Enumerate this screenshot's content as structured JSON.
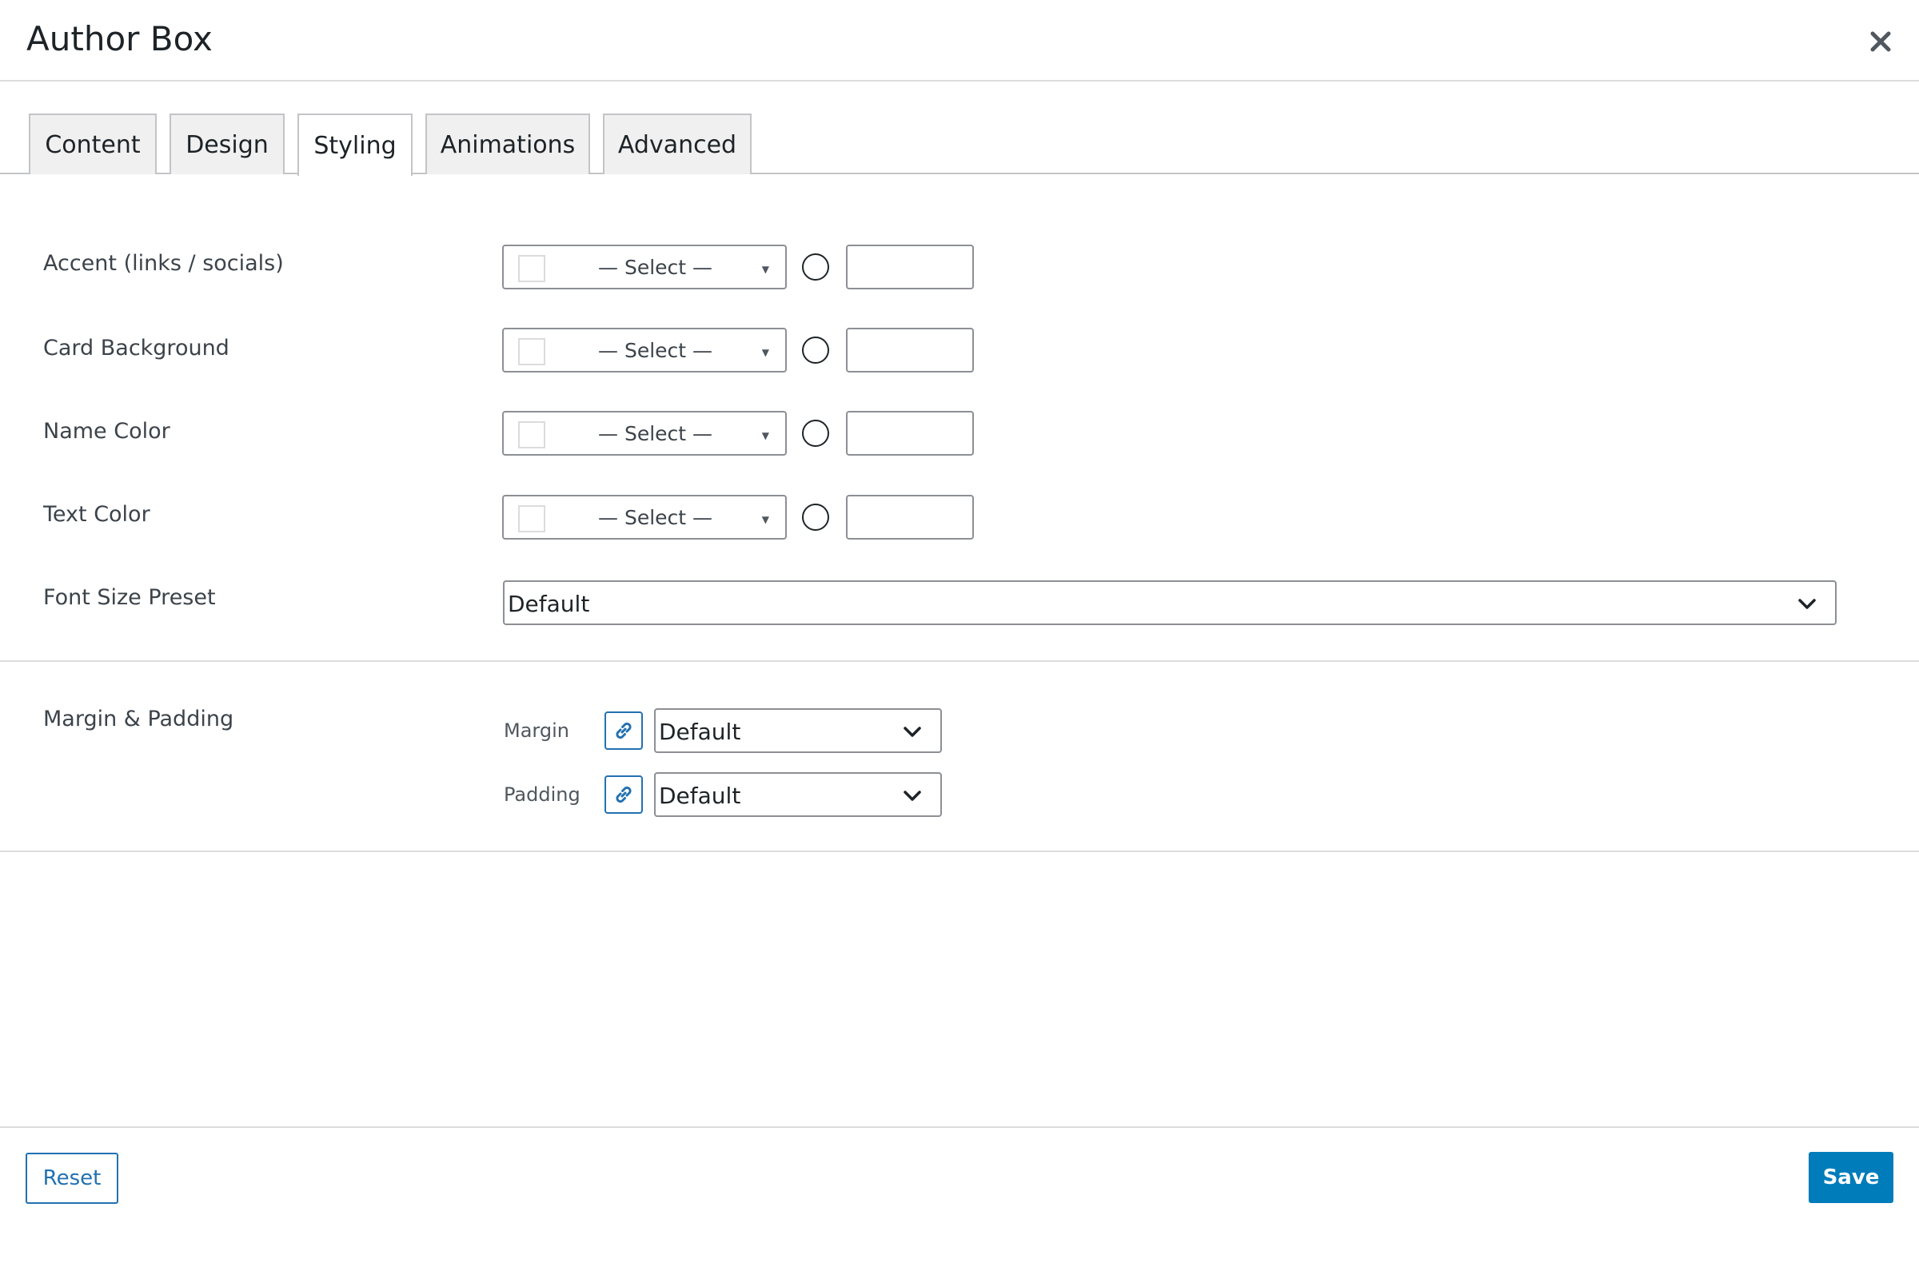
{
  "header": {
    "title": "Author Box"
  },
  "tabs": [
    {
      "label": "Content",
      "active": false
    },
    {
      "label": "Design",
      "active": false
    },
    {
      "label": "Styling",
      "active": true
    },
    {
      "label": "Animations",
      "active": false
    },
    {
      "label": "Advanced",
      "active": false
    }
  ],
  "styling": {
    "color_rows": [
      {
        "label": "Accent (links / socials)",
        "select_text": "— Select —",
        "hex_value": ""
      },
      {
        "label": "Card Background",
        "select_text": "— Select —",
        "hex_value": ""
      },
      {
        "label": "Name Color",
        "select_text": "— Select —",
        "hex_value": ""
      },
      {
        "label": "Text Color",
        "select_text": "— Select —",
        "hex_value": ""
      }
    ],
    "font_size": {
      "label": "Font Size Preset",
      "value": "Default"
    },
    "spacing": {
      "label": "Margin & Padding",
      "margin_label": "Margin",
      "margin_value": "Default",
      "padding_label": "Padding",
      "padding_value": "Default"
    }
  },
  "footer": {
    "reset_label": "Reset",
    "save_label": "Save"
  },
  "colors": {
    "primary": "#007cba",
    "link": "#2271b1",
    "border": "#8c8f94"
  }
}
